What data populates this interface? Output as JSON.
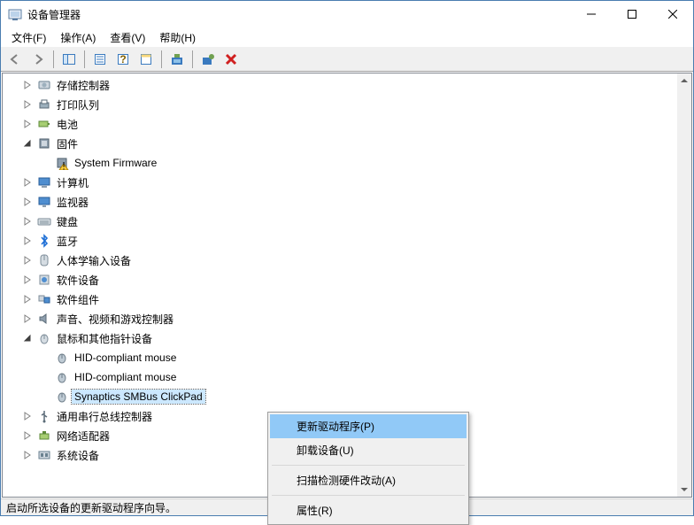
{
  "window": {
    "title": "设备管理器"
  },
  "menu": {
    "file": "文件(F)",
    "action": "操作(A)",
    "view": "查看(V)",
    "help": "帮助(H)"
  },
  "tree": {
    "items": [
      {
        "label": "存储控制器",
        "expander": "closed",
        "indent": 1,
        "icon": "storage"
      },
      {
        "label": "打印队列",
        "expander": "closed",
        "indent": 1,
        "icon": "printer"
      },
      {
        "label": "电池",
        "expander": "closed",
        "indent": 1,
        "icon": "battery"
      },
      {
        "label": "固件",
        "expander": "open",
        "indent": 1,
        "icon": "chip"
      },
      {
        "label": "System Firmware",
        "expander": "none",
        "indent": 2,
        "icon": "chip-warn"
      },
      {
        "label": "计算机",
        "expander": "closed",
        "indent": 1,
        "icon": "computer"
      },
      {
        "label": "监视器",
        "expander": "closed",
        "indent": 1,
        "icon": "monitor"
      },
      {
        "label": "键盘",
        "expander": "closed",
        "indent": 1,
        "icon": "keyboard"
      },
      {
        "label": "蓝牙",
        "expander": "closed",
        "indent": 1,
        "icon": "bluetooth"
      },
      {
        "label": "人体学输入设备",
        "expander": "closed",
        "indent": 1,
        "icon": "hid"
      },
      {
        "label": "软件设备",
        "expander": "closed",
        "indent": 1,
        "icon": "sw"
      },
      {
        "label": "软件组件",
        "expander": "closed",
        "indent": 1,
        "icon": "swcomp"
      },
      {
        "label": "声音、视频和游戏控制器",
        "expander": "closed",
        "indent": 1,
        "icon": "audio"
      },
      {
        "label": "鼠标和其他指针设备",
        "expander": "open",
        "indent": 1,
        "icon": "mouse"
      },
      {
        "label": "HID-compliant mouse",
        "expander": "none",
        "indent": 2,
        "icon": "mouse-dev"
      },
      {
        "label": "HID-compliant mouse",
        "expander": "none",
        "indent": 2,
        "icon": "mouse-dev"
      },
      {
        "label": "Synaptics SMBus ClickPad",
        "expander": "none",
        "indent": 2,
        "icon": "mouse-dev",
        "selected": true
      },
      {
        "label": "通用串行总线控制器",
        "expander": "closed",
        "indent": 1,
        "icon": "usb"
      },
      {
        "label": "网络适配器",
        "expander": "closed",
        "indent": 1,
        "icon": "network"
      },
      {
        "label": "系统设备",
        "expander": "closed",
        "indent": 1,
        "icon": "system"
      }
    ]
  },
  "context_menu": {
    "update_driver": "更新驱动程序(P)",
    "uninstall": "卸载设备(U)",
    "scan": "扫描检测硬件改动(A)",
    "properties": "属性(R)"
  },
  "statusbar": {
    "text": "启动所选设备的更新驱动程序向导。"
  }
}
